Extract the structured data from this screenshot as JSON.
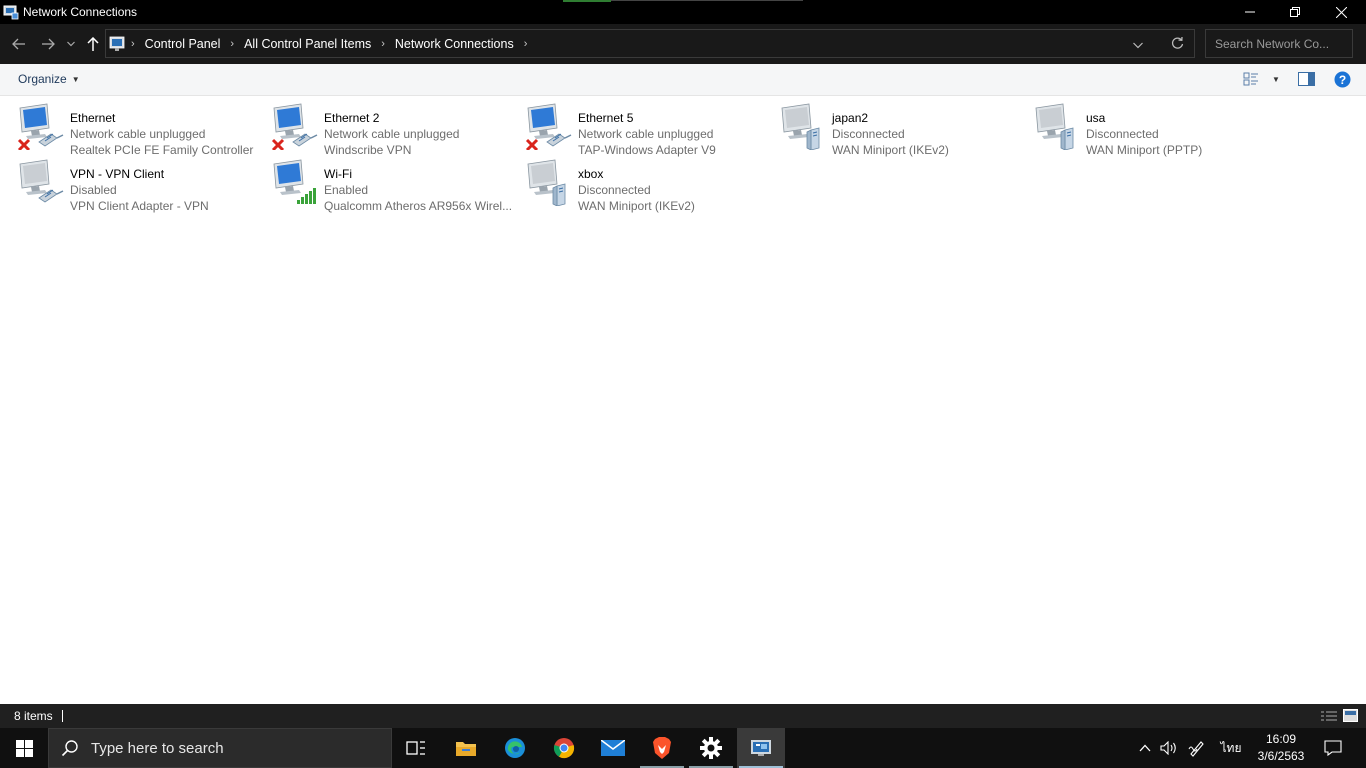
{
  "window": {
    "title": "Network Connections"
  },
  "address": {
    "crumbs": [
      "Control Panel",
      "All Control Panel Items",
      "Network Connections"
    ]
  },
  "search": {
    "placeholder": "Search Network Co..."
  },
  "toolbar": {
    "organize_label": "Organize"
  },
  "connections": [
    {
      "name": "Ethernet",
      "status": "Network cable unplugged",
      "device": "Realtek PCIe FE Family Controller",
      "badge": "red-x-icon",
      "adapter": "cable-icon"
    },
    {
      "name": "Ethernet 2",
      "status": "Network cable unplugged",
      "device": "Windscribe VPN",
      "badge": "red-x-icon",
      "adapter": "cable-icon"
    },
    {
      "name": "Ethernet 5",
      "status": "Network cable unplugged",
      "device": "TAP-Windows Adapter V9",
      "badge": "red-x-icon",
      "adapter": "cable-icon"
    },
    {
      "name": "japan2",
      "status": "Disconnected",
      "device": "WAN Miniport (IKEv2)",
      "badge": "",
      "adapter": "server-icon"
    },
    {
      "name": "usa",
      "status": "Disconnected",
      "device": "WAN Miniport (PPTP)",
      "badge": "",
      "adapter": "server-icon"
    },
    {
      "name": "VPN - VPN Client",
      "status": "Disabled",
      "device": "VPN Client Adapter - VPN",
      "badge": "",
      "adapter": "cable-icon"
    },
    {
      "name": "Wi-Fi",
      "status": "Enabled",
      "device": "Qualcomm Atheros AR956x Wirel...",
      "badge": "",
      "adapter": "signal-bars-icon"
    },
    {
      "name": "xbox",
      "status": "Disconnected",
      "device": "WAN Miniport (IKEv2)",
      "badge": "",
      "adapter": "server-icon"
    }
  ],
  "statusbar": {
    "item_count": "8 items"
  },
  "taskbar": {
    "search_placeholder": "Type here to search",
    "apps": [
      "task-view-icon",
      "file-explorer-icon",
      "edge-icon",
      "chrome-icon",
      "mail-icon",
      "brave-icon",
      "settings-icon",
      "control-panel-icon"
    ],
    "language": "ไทย",
    "time": "16:09",
    "date": "3/6/2563"
  },
  "colors": {
    "titlebar": "#000000",
    "addressbar": "#191919",
    "accent_green": "#2f7d32",
    "help_blue": "#1a73d6",
    "error_red": "#d9241c"
  }
}
